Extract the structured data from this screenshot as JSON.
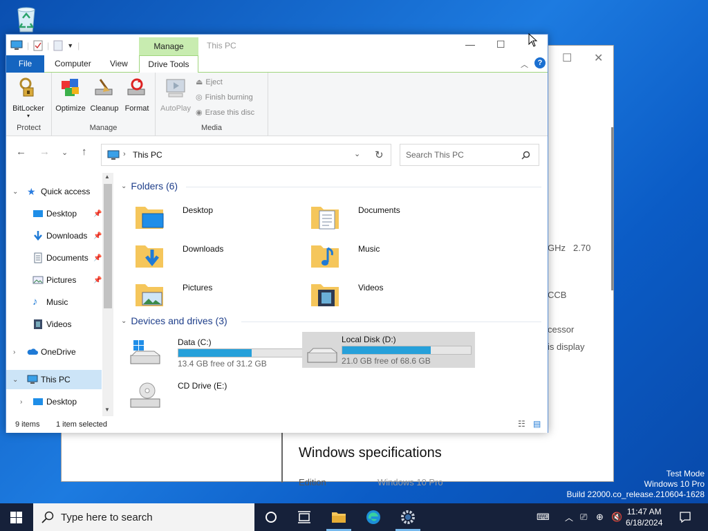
{
  "explorer": {
    "title": "This PC",
    "context_tab": "Manage",
    "tabs": [
      "File",
      "Computer",
      "View",
      "Drive Tools"
    ],
    "ribbon": {
      "protect": {
        "label": "Protect",
        "bitlocker": "BitLocker"
      },
      "manage": {
        "label": "Manage",
        "optimize": "Optimize",
        "cleanup": "Cleanup",
        "format": "Format"
      },
      "media": {
        "label": "Media",
        "autoplay": "AutoPlay",
        "eject": "Eject",
        "finish_burning": "Finish burning",
        "erase_disc": "Erase this disc"
      }
    },
    "address": "This PC",
    "search_placeholder": "Search This PC",
    "sidebar": {
      "quick_access": "Quick access",
      "items": [
        {
          "label": "Desktop",
          "pinned": true
        },
        {
          "label": "Downloads",
          "pinned": true
        },
        {
          "label": "Documents",
          "pinned": true
        },
        {
          "label": "Pictures",
          "pinned": true
        },
        {
          "label": "Music",
          "pinned": false
        },
        {
          "label": "Videos",
          "pinned": false
        }
      ],
      "onedrive": "OneDrive",
      "this_pc": "This PC",
      "this_pc_desktop": "Desktop"
    },
    "folders_header": "Folders (6)",
    "folders": [
      "Desktop",
      "Documents",
      "Downloads",
      "Music",
      "Pictures",
      "Videos"
    ],
    "drives_header": "Devices and drives (3)",
    "drives": [
      {
        "name": "Data (C:)",
        "free_text": "13.4 GB free of 31.2 GB",
        "used_fraction": 0.57
      },
      {
        "name": "Local Disk (D:)",
        "free_text": "21.0 GB free of 68.6 GB",
        "used_fraction": 0.69
      },
      {
        "name": "CD Drive (E:)"
      }
    ],
    "status": {
      "items": "9 items",
      "selected": "1 item selected"
    }
  },
  "background_window": {
    "fragments": [
      "GHz",
      "2.70",
      "CCB",
      "cessor",
      "is display"
    ],
    "section_title": "Windows specifications",
    "edition_label": "Edition",
    "edition_value": "Windows 10 Pro"
  },
  "watermark": {
    "line1": "Test Mode",
    "line2": "Windows 10 Pro",
    "line3": "Build 22000.co_release.210604-1628"
  },
  "taskbar": {
    "search_placeholder": "Type here to search",
    "time": "11:47 AM",
    "date": "6/18/2024"
  },
  "colors": {
    "accent": "#1565c0",
    "progress": "#26a0da",
    "manage_tab": "#c8ecb0"
  }
}
